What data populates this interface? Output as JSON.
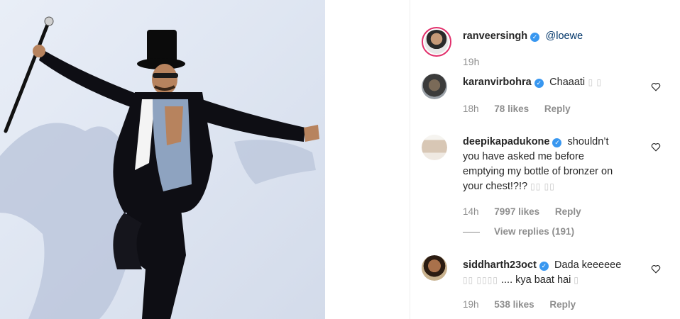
{
  "post": {
    "author": "ranveersingh",
    "caption_mention": "@loewe",
    "time": "19h"
  },
  "comments": [
    {
      "username": "karanvirbohra",
      "text": "Chaaati",
      "emoji_tail": "▯ ▯",
      "time": "18h",
      "likes": "78 likes",
      "reply": "Reply"
    },
    {
      "username": "deepikapadukone",
      "text_line1": "shouldn’t",
      "text_line2": "you have asked me before",
      "text_line3": "emptying my bottle of bronzer on",
      "text_line4": "your chest!?!?",
      "emoji_tail": "▯▯ ▯▯",
      "time": "14h",
      "likes": "7997 likes",
      "reply": "Reply",
      "view_replies": "View replies (191)"
    },
    {
      "username": "siddharth23oct",
      "text_line1": "Dada keeeeee",
      "emoji_head": "▯▯ ▯▯▯▯",
      "text_line2": ".... kya baat hai",
      "emoji_tail": "▯",
      "time": "19h",
      "likes": "538 likes",
      "reply": "Reply"
    }
  ],
  "colors": {
    "verified": "#3897f0",
    "muted": "#8e8e8e",
    "mention": "#003569",
    "ring": "#e1306c"
  },
  "icons": [
    "heart-outline-icon",
    "verified-badge-icon"
  ]
}
